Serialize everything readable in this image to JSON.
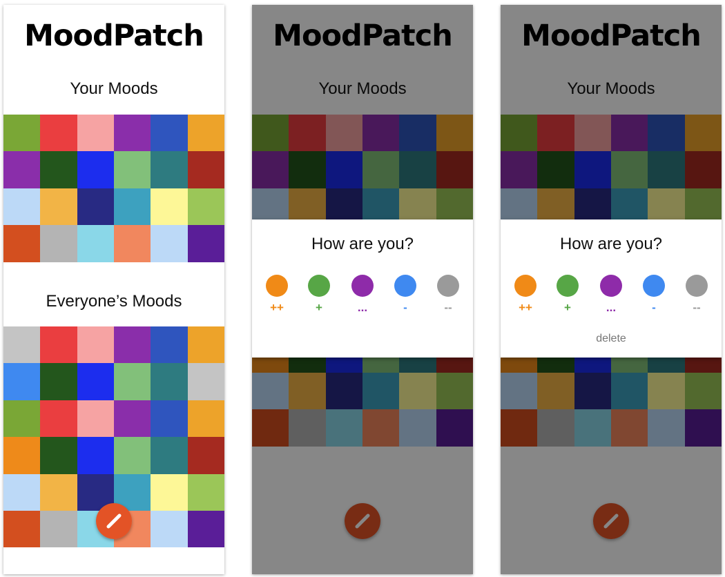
{
  "app": {
    "title": "MoodPatch"
  },
  "sections": {
    "your_moods": "Your Moods",
    "everyones_moods": "Everyone’s Moods"
  },
  "colors": {
    "fab": "#e35326",
    "scrim": "rgba(0,0,0,0.47)"
  },
  "your_moods_grid": [
    "#7aa736",
    "#ea3e40",
    "#f6a3a3",
    "#8a2eaa",
    "#2f55be",
    "#eda32a",
    "#8a2eaa",
    "#23561c",
    "#1c2dee",
    "#82c07a",
    "#2e7b80",
    "#a52a20",
    "#bcd9f7",
    "#f2b446",
    "#282a83",
    "#3da1bf",
    "#fdf797",
    "#9bc658",
    "#d34f1f",
    "#b4b4b4",
    "#8ad7e8",
    "#f1875e",
    "#bcd9f7",
    "#5a1e98"
  ],
  "everyones_moods_grid": [
    "#c4c4c4",
    "#ea3e40",
    "#f6a3a3",
    "#8a2eaa",
    "#2f55be",
    "#eda32a",
    "#3f89f0",
    "#23561c",
    "#1c2dee",
    "#82c07a",
    "#2e7b80",
    "#c4c4c4",
    "#7aa736",
    "#ea3e40",
    "#f6a3a3",
    "#8a2eaa",
    "#2f55be",
    "#eda32a",
    "#ee8a1a",
    "#23561c",
    "#1c2dee",
    "#82c07a",
    "#2e7b80",
    "#a52a20",
    "#bcd9f7",
    "#f2b446",
    "#282a83",
    "#3da1bf",
    "#fdf797",
    "#9bc658",
    "#d34f1f",
    "#b4b4b4",
    "#8ad7e8",
    "#f1875e",
    "#bcd9f7",
    "#5a1e98"
  ],
  "overlay_background_grid": [
    "#7aa736",
    "#ea3e40",
    "#f6a3a3",
    "#8a2eaa",
    "#2f55be",
    "#eda32a",
    "#8a2eaa",
    "#23561c",
    "#1c2dee",
    "#82c07a",
    "#2e7b80",
    "#a52a20",
    "#bcd9f7",
    "#f2b446",
    "#282a83",
    "#3da1bf",
    "#fdf797",
    "#9bc658",
    "#d34f1f",
    "#b4b4b4",
    "#8ad7e8",
    "#f1875e",
    "#bcd9f7",
    "#5a1e98",
    "#4a88ec",
    "#23561c",
    "#1c2dee",
    "#82c07a",
    "#2e7b80",
    "#c4c4c4",
    "#7aa736",
    "#ea3e40",
    "#f6a3a3",
    "#8a2eaa",
    "#2f55be",
    "#eda32a",
    "#ee8a1a",
    "#23561c",
    "#1c2dee",
    "#82c07a",
    "#2e7b80",
    "#a52a20",
    "#bcd9f7",
    "#f2b446",
    "#282a83",
    "#3da1bf",
    "#fdf797",
    "#9bc658",
    "#d34f1f",
    "#b4b4b4",
    "#8ad7e8",
    "#f1875e",
    "#bcd9f7",
    "#5a1e98"
  ],
  "dialog": {
    "title": "How are you?",
    "options": [
      {
        "label": "++",
        "color": "#f08a17"
      },
      {
        "label": "+",
        "color": "#57a646"
      },
      {
        "label": "...",
        "color": "#8e2ba9"
      },
      {
        "label": "-",
        "color": "#3f89f0"
      },
      {
        "label": "--",
        "color": "#9a9a9a"
      }
    ],
    "delete_label": "delete"
  }
}
